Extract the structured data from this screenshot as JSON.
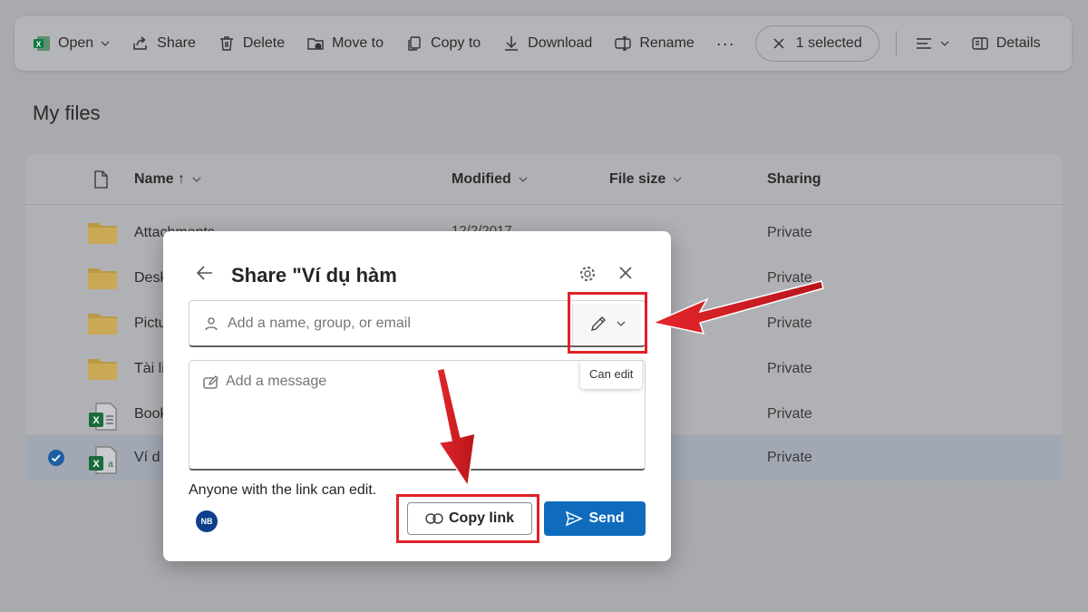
{
  "toolbar": {
    "open": "Open",
    "share": "Share",
    "delete": "Delete",
    "move_to": "Move to",
    "copy_to": "Copy to",
    "download": "Download",
    "rename": "Rename",
    "more": "···",
    "selected": "1 selected",
    "details": "Details"
  },
  "page_title": "My files",
  "file_list": {
    "columns": {
      "name": "Name ↑",
      "modified": "Modified",
      "file_size": "File size",
      "sharing": "Sharing"
    },
    "rows": [
      {
        "name": "Attachments",
        "modified": "12/2/2017",
        "sharing": "Private",
        "icon": "folder-icon"
      },
      {
        "name": "Desk",
        "modified": "",
        "sharing": "Private",
        "icon": "folder-icon"
      },
      {
        "name": "Pictu",
        "modified": "",
        "sharing": "Private",
        "icon": "folder-icon"
      },
      {
        "name": "Tài li",
        "modified": "",
        "sharing": "Private",
        "icon": "folder-icon"
      },
      {
        "name": "Book",
        "modified": "",
        "sharing": "Private",
        "icon": "excel-file-icon"
      },
      {
        "name": "Ví d",
        "modified": "",
        "sharing": "Private",
        "icon": "excel-file-icon",
        "selected": true
      }
    ]
  },
  "dialog": {
    "title": "Share \"Ví dụ hàm",
    "recipient_placeholder": "Add a name, group, or email",
    "permission_tooltip": "Can edit",
    "message_placeholder": "Add a message",
    "link_info": "Anyone with the link can edit.",
    "avatar_initials": "NB",
    "copy_link": "Copy link",
    "send": "Send"
  },
  "colors": {
    "accent": "#0f6cbd",
    "highlight": "#e02228",
    "excel_green": "#107c41",
    "folder_yellow": "#d9b24a"
  }
}
